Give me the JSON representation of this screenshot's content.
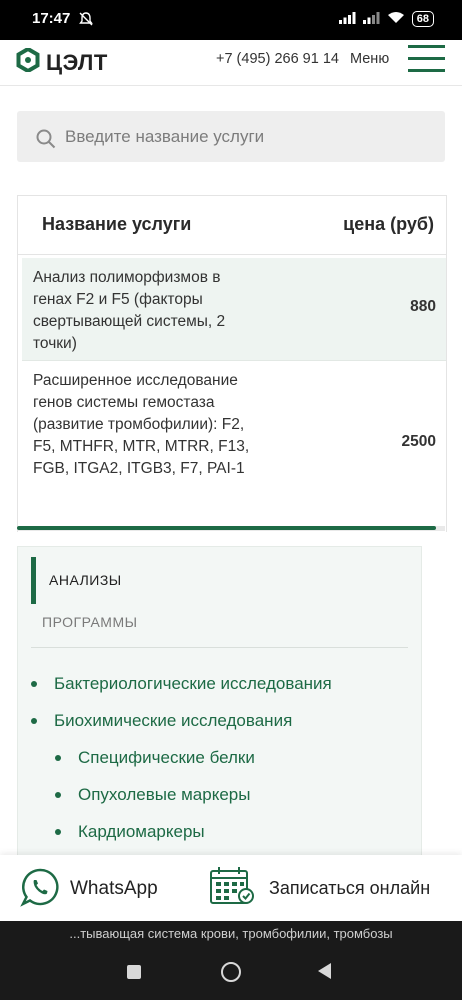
{
  "status_bar": {
    "time": "17:47",
    "battery": "68"
  },
  "header": {
    "logo_text": "ЦЭЛТ",
    "phone": "+7 (495) 266 91 14",
    "menu_label": "Меню"
  },
  "search": {
    "placeholder": "Введите название услуги"
  },
  "table": {
    "headers": {
      "name": "Название услуги",
      "price": "цена (руб)"
    },
    "rows": [
      {
        "name": "Анализ полиморфизмов в генах F2 и F5 (факторы свертывающей системы, 2 точки)",
        "price": "880"
      },
      {
        "name": "Расширенное исследование генов системы гемостаза (развитие тромбофилии): F2, F5, MTHFR, MTR, MTRR, F13, FGB, ITGA2, ITGB3, F7, PAI-1",
        "price": "2500"
      }
    ],
    "scroll_fraction": 0.98
  },
  "categories": {
    "tabs": [
      "АНАЛИЗЫ",
      "ПРОГРАММЫ"
    ],
    "items": [
      "Бактериологические исследования",
      "Биохимические исследования",
      "Специфические белки",
      "Опухолевые маркеры",
      "Кардиомаркеры"
    ]
  },
  "cta": {
    "whatsapp_label": "WhatsApp",
    "book_label": "Записаться онлайн"
  },
  "url_bar": {
    "text": "...тывающая система крови, тромбофилии, тромбозы"
  },
  "colors": {
    "brand_green": "#1d6a45",
    "row_highlight": "#eef4f1",
    "panel_bg": "#f3f7f5"
  },
  "icons": [
    "mute-bell-icon",
    "signal-icon",
    "wifi-icon",
    "battery-icon",
    "logo-icon",
    "burger-menu-icon",
    "search-icon",
    "whatsapp-icon",
    "calendar-icon"
  ]
}
